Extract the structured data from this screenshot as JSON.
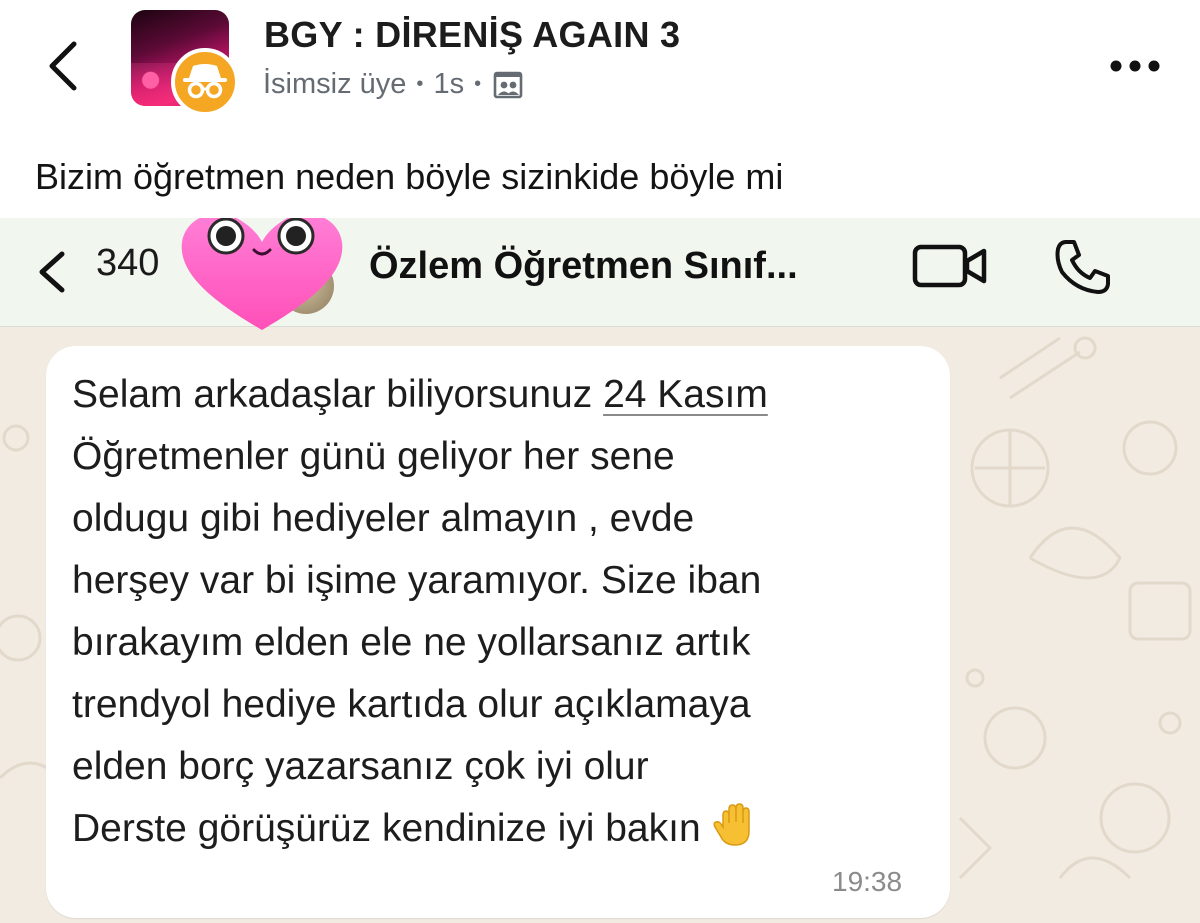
{
  "post": {
    "group_name": "BGY : DİRENİŞ AGAIN 3",
    "author": "İsimsiz üye",
    "separator": "•",
    "time": "1s",
    "body": "Bizim öğretmen neden böyle sizinkide böyle mi"
  },
  "icons": {
    "back": "chevron-left-icon",
    "more": "more-dots-icon",
    "audience": "group-audience-icon",
    "anon": "anonymous-incognito-icon",
    "video": "video-camera-icon",
    "call": "phone-icon",
    "sticker": "heart-face-sticker",
    "emoji": "raised-hand-emoji"
  },
  "colors": {
    "anon_badge": "#f5a623",
    "wa_header_bg": "#f1f6ef",
    "wa_chat_bg": "#f1ebe2",
    "heart": "#ff5ec4"
  },
  "chat": {
    "unread_count": "340",
    "title": "Özlem Öğretmen Sınıf...",
    "message": {
      "line1_before": "Selam arkadaşlar biliyorsunuz ",
      "line1_date": "24 Kasım",
      "lines": [
        "Öğretmenler günü geliyor her sene",
        "oldugu gibi hediyeler almayın , evde",
        "herşey var bi işime yaramıyor. Size iban",
        "bırakayım elden ele ne yollarsanız artık",
        "trendyol hediye kartıda olur açıklamaya",
        "elden borç yazarsanız çok iyi olur"
      ],
      "last_line": "Derste görüşürüz kendinize iyi bakın",
      "time": "19:38"
    }
  }
}
